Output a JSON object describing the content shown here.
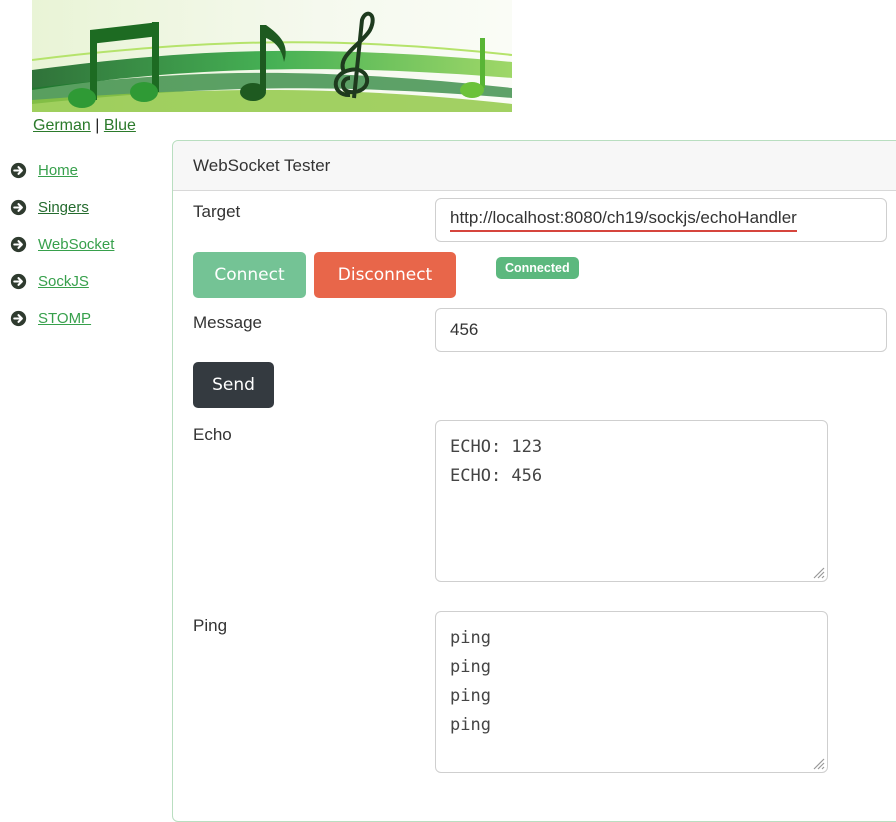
{
  "language_links": {
    "german": "German",
    "separator": "|",
    "blue": "Blue"
  },
  "nav": {
    "items": [
      {
        "label": "Home"
      },
      {
        "label": "Singers"
      },
      {
        "label": "WebSocket"
      },
      {
        "label": "SockJS"
      },
      {
        "label": "STOMP"
      }
    ],
    "icon": "circle-arrow-right-icon"
  },
  "panel": {
    "title": "WebSocket Tester",
    "target_label": "Target",
    "target_value": "http://localhost:8080/ch19/sockjs/echoHandler",
    "connect_label": "Connect",
    "disconnect_label": "Disconnect",
    "status_badge": "Connected",
    "message_label": "Message",
    "message_value": "456",
    "send_label": "Send",
    "echo_label": "Echo",
    "echo_lines": [
      "ECHO: 123",
      "ECHO: 456"
    ],
    "ping_label": "Ping",
    "ping_lines": [
      "ping",
      "ping",
      "ping",
      "ping"
    ]
  },
  "colors": {
    "connect": "#74c395",
    "disconnect": "#e8664a",
    "send": "#343a40",
    "badge": "#5cb87e",
    "nav_link": "#37a04c",
    "card_border": "#b9dec0"
  }
}
